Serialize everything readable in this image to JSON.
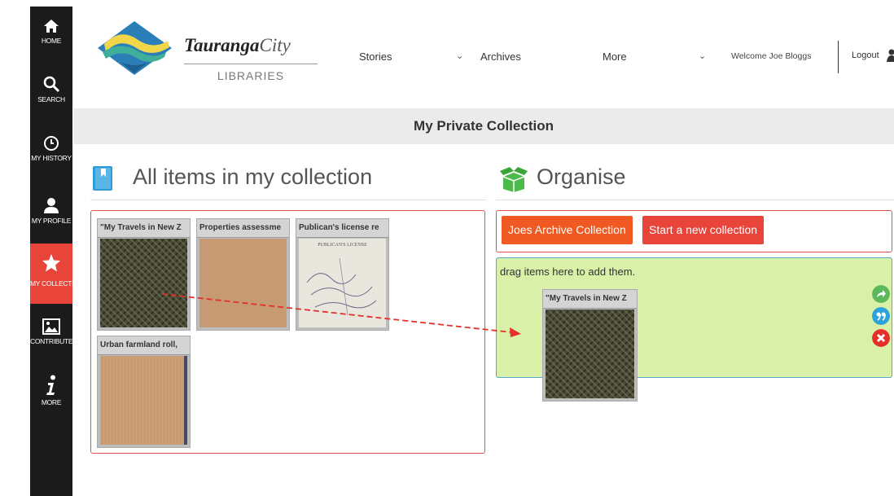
{
  "sidebar": {
    "items": [
      {
        "label": "HOME",
        "icon": "home-icon"
      },
      {
        "label": "SEARCH",
        "icon": "search-icon"
      },
      {
        "label": "MY HISTORY",
        "icon": "clock-icon"
      },
      {
        "label": "MY PROFILE",
        "icon": "user-icon"
      },
      {
        "label": "MY COLLECTION",
        "icon": "star-icon",
        "active": true
      },
      {
        "label": "CONTRIBUTE",
        "icon": "image-icon"
      },
      {
        "label": "MORE",
        "icon": "info-icon"
      }
    ]
  },
  "header": {
    "logo_name_bold": "Tauranga",
    "logo_name_light": "City",
    "logo_subtitle": "LIBRARIES",
    "nav": [
      "Stories",
      "Archives",
      "More"
    ],
    "welcome": "Welcome Joe Bloggs",
    "logout": "Logout"
  },
  "page": {
    "title": "My Private Collection"
  },
  "collection": {
    "heading": "All items in my collection",
    "items": [
      {
        "title": "\"My Travels in New Z",
        "thumb": "green"
      },
      {
        "title": "Properties assessme",
        "thumb": "tan"
      },
      {
        "title": "Publican's license re",
        "thumb": "paper",
        "caption": "PUBLICAN'S LICENSE"
      },
      {
        "title": "Urban farmland roll,",
        "thumb": "sand"
      }
    ]
  },
  "organise": {
    "heading": "Organise",
    "buttons": [
      "Joes Archive Collection",
      "Start a new collection"
    ],
    "drop_hint": "drag items here to add them.",
    "dragged_item": {
      "title": "\"My Travels in New Z"
    }
  },
  "colors": {
    "sidebar_bg": "#1b1b1b",
    "active": "#e8443a",
    "orange": "#f05a22",
    "drop_bg": "#d8f0a8",
    "action_green": "#5cb85c",
    "action_blue": "#2aa3dc",
    "action_red": "#e5302a"
  }
}
